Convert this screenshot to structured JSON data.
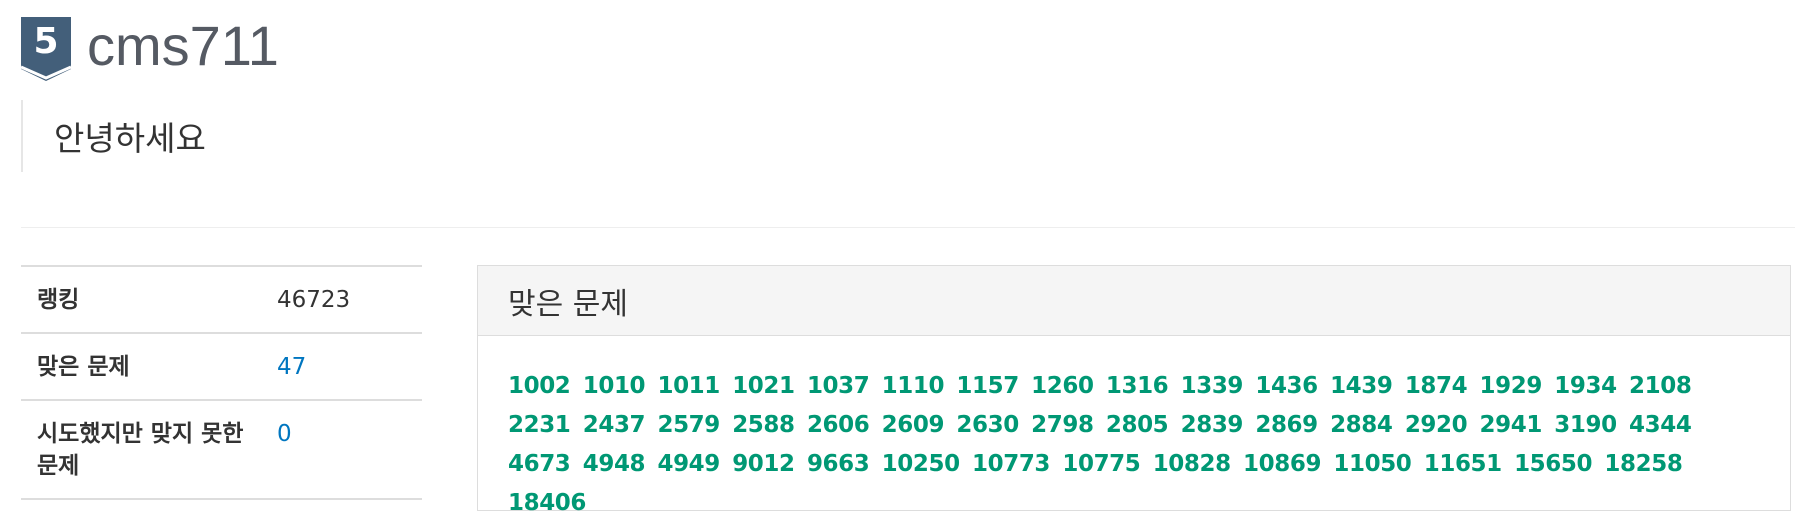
{
  "profile": {
    "tier_number": "5",
    "username": "cms711",
    "status_message": "안녕하세요"
  },
  "stats": {
    "rows": [
      {
        "label": "랭킹",
        "value": "46723"
      },
      {
        "label": "맞은 문제",
        "value": "47"
      },
      {
        "label": "시도했지만 맞지 못한 문제",
        "value": "0"
      }
    ]
  },
  "solved_panel": {
    "title": "맞은 문제",
    "problems": [
      "1002",
      "1010",
      "1011",
      "1021",
      "1037",
      "1110",
      "1157",
      "1260",
      "1316",
      "1339",
      "1436",
      "1439",
      "1874",
      "1929",
      "1934",
      "2108",
      "2231",
      "2437",
      "2579",
      "2588",
      "2606",
      "2609",
      "2630",
      "2798",
      "2805",
      "2839",
      "2869",
      "2884",
      "2920",
      "2941",
      "3190",
      "4344",
      "4673",
      "4948",
      "4949",
      "9012",
      "9663",
      "10250",
      "10773",
      "10775",
      "10828",
      "10869",
      "11050",
      "11651",
      "15650",
      "18258",
      "18406"
    ]
  },
  "colors": {
    "tier_badge": "#435f7a",
    "username": "#555a63",
    "problem_link": "#009874",
    "stat_link": "#0076c0"
  },
  "icons": {
    "tier_badge": "shield-badge-icon"
  }
}
